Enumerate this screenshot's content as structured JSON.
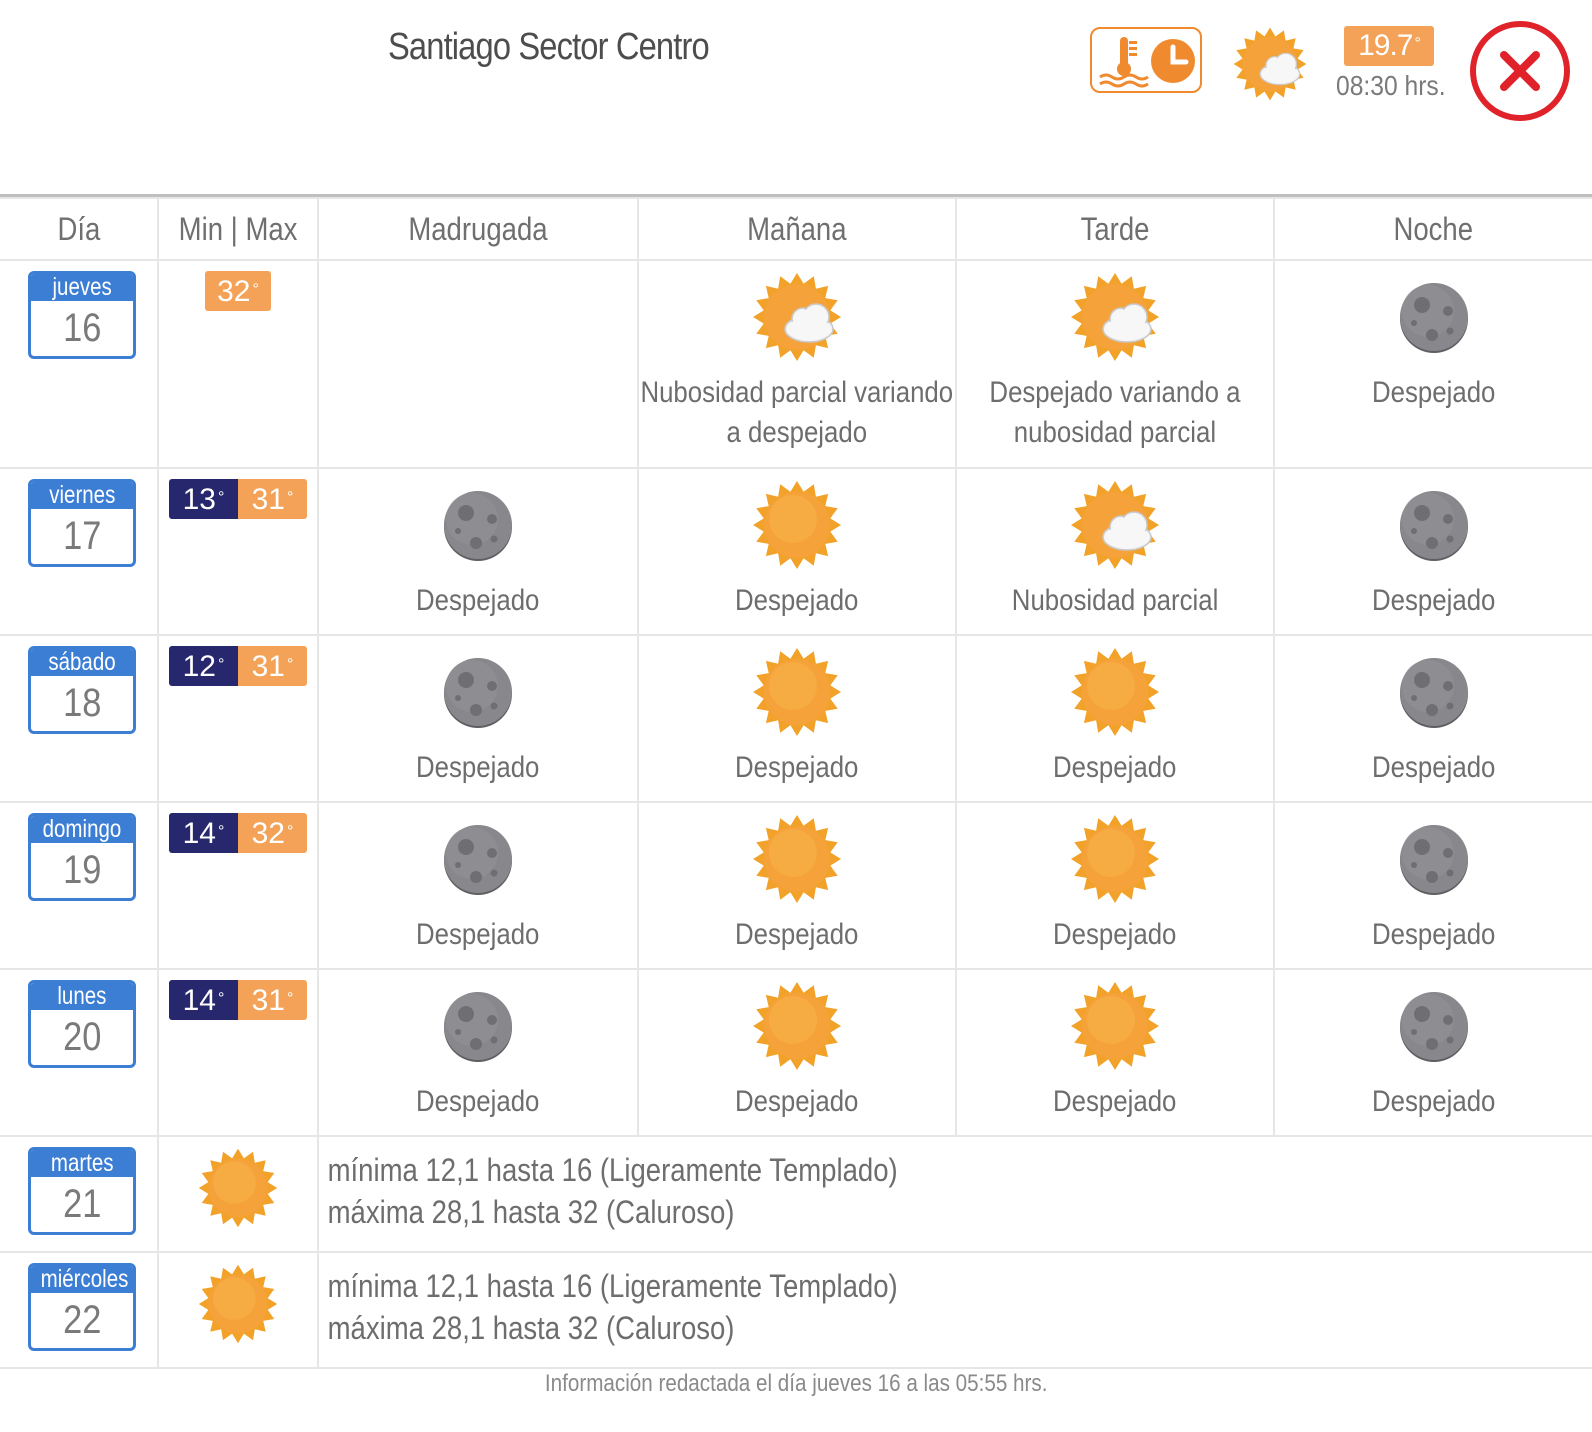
{
  "header": {
    "title": "Santiago Sector Centro",
    "current_temp": "19.7",
    "current_time": "08:30 hrs.",
    "current_icon": "partly-cloudy-icon"
  },
  "columns": [
    "Día",
    "Min | Max",
    "Madrugada",
    "Mañana",
    "Tarde",
    "Noche"
  ],
  "days": [
    {
      "weekday": "jueves",
      "day": "16",
      "min": "",
      "max": "32",
      "periods": [
        {
          "icon": "",
          "text": []
        },
        {
          "icon": "partly-cloudy",
          "text": [
            "Nubosidad parcial variando",
            "a despejado"
          ]
        },
        {
          "icon": "partly-cloudy",
          "text": [
            "Despejado variando a",
            "nubosidad parcial"
          ]
        },
        {
          "icon": "moon",
          "text": [
            "Despejado"
          ]
        }
      ]
    },
    {
      "weekday": "viernes",
      "day": "17",
      "min": "13",
      "max": "31",
      "periods": [
        {
          "icon": "moon",
          "text": [
            "Despejado"
          ]
        },
        {
          "icon": "sun",
          "text": [
            "Despejado"
          ]
        },
        {
          "icon": "partly-cloudy",
          "text": [
            "Nubosidad parcial"
          ]
        },
        {
          "icon": "moon",
          "text": [
            "Despejado"
          ]
        }
      ]
    },
    {
      "weekday": "sábado",
      "day": "18",
      "min": "12",
      "max": "31",
      "periods": [
        {
          "icon": "moon",
          "text": [
            "Despejado"
          ]
        },
        {
          "icon": "sun",
          "text": [
            "Despejado"
          ]
        },
        {
          "icon": "sun",
          "text": [
            "Despejado"
          ]
        },
        {
          "icon": "moon",
          "text": [
            "Despejado"
          ]
        }
      ]
    },
    {
      "weekday": "domingo",
      "day": "19",
      "min": "14",
      "max": "32",
      "periods": [
        {
          "icon": "moon",
          "text": [
            "Despejado"
          ]
        },
        {
          "icon": "sun",
          "text": [
            "Despejado"
          ]
        },
        {
          "icon": "sun",
          "text": [
            "Despejado"
          ]
        },
        {
          "icon": "moon",
          "text": [
            "Despejado"
          ]
        }
      ]
    },
    {
      "weekday": "lunes",
      "day": "20",
      "min": "14",
      "max": "31",
      "periods": [
        {
          "icon": "moon",
          "text": [
            "Despejado"
          ]
        },
        {
          "icon": "sun",
          "text": [
            "Despejado"
          ]
        },
        {
          "icon": "sun",
          "text": [
            "Despejado"
          ]
        },
        {
          "icon": "moon",
          "text": [
            "Despejado"
          ]
        }
      ]
    }
  ],
  "extended": [
    {
      "weekday": "martes",
      "day": "21",
      "icon": "sun",
      "lines": [
        "mínima 12,1 hasta 16 (Ligeramente Templado)",
        "máxima 28,1 hasta 32 (Caluroso)"
      ]
    },
    {
      "weekday": "miércoles",
      "day": "22",
      "icon": "sun",
      "lines": [
        "mínima 12,1 hasta 16 (Ligeramente Templado)",
        "máxima 28,1 hasta 32 (Caluroso)"
      ]
    }
  ],
  "footer": "Información redactada el día jueves 16 a las 05:55 hrs.",
  "colors": {
    "accent_orange": "#f08a2e",
    "max_temp": "#f3a257",
    "min_temp": "#27276e",
    "calendar_blue": "#3c7ed4",
    "close_red": "#e0232a"
  }
}
